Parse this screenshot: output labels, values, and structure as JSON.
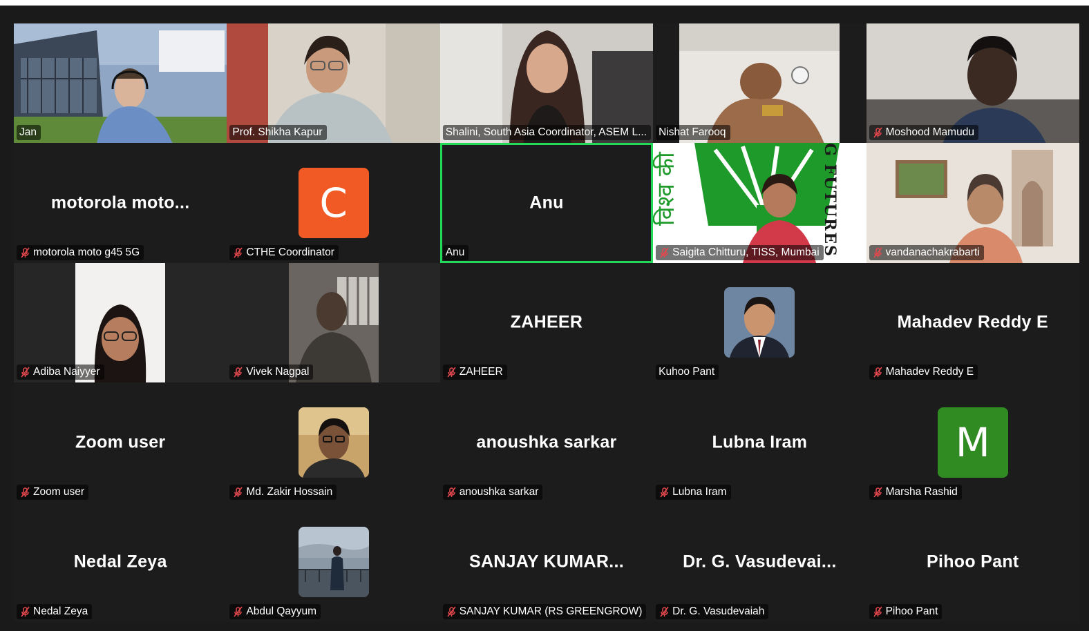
{
  "colors": {
    "background": "#1a1a1a",
    "active_speaker": "#23d959",
    "muted_icon": "#e5484d",
    "avatar_orange": "#f15a24",
    "avatar_green": "#2f8b22"
  },
  "tiles": [
    {
      "label": "Jan",
      "muted": false
    },
    {
      "label": "Prof. Shikha Kapur",
      "muted": false
    },
    {
      "label": "Shalini, South Asia Coordinator, ASEM L...",
      "muted": false
    },
    {
      "label": "Nishat Farooq",
      "muted": false
    },
    {
      "label": "Moshood Mamudu",
      "muted": true
    },
    {
      "label": "motorola moto g45 5G",
      "muted": true,
      "display": "motorola  moto..."
    },
    {
      "label": "CTHE Coordinator",
      "muted": true,
      "avatar_letter": "C"
    },
    {
      "label": "Anu",
      "muted": false,
      "display": "Anu",
      "active": true
    },
    {
      "label": "Saigita Chitturu, TISS, Mumbai",
      "muted": true,
      "background_text": "G FUTURES"
    },
    {
      "label": "vandanachakrabarti",
      "muted": true
    },
    {
      "label": "Adiba Naiyyer",
      "muted": true
    },
    {
      "label": "Vivek Nagpal",
      "muted": true
    },
    {
      "label": "ZAHEER",
      "muted": true,
      "display": "ZAHEER"
    },
    {
      "label": "Kuhoo Pant",
      "muted": false
    },
    {
      "label": "Mahadev Reddy E",
      "muted": true,
      "display": "Mahadev Reddy E"
    },
    {
      "label": "Zoom user",
      "muted": true,
      "display": "Zoom user"
    },
    {
      "label": "Md. Zakir Hossain",
      "muted": true
    },
    {
      "label": "anoushka sarkar",
      "muted": true,
      "display": "anoushka sarkar"
    },
    {
      "label": "Lubna Iram",
      "muted": true,
      "display": "Lubna Iram"
    },
    {
      "label": "Marsha Rashid",
      "muted": true,
      "avatar_letter": "M"
    },
    {
      "label": "Nedal Zeya",
      "muted": true,
      "display": "Nedal Zeya"
    },
    {
      "label": "Abdul Qayyum",
      "muted": true
    },
    {
      "label": "SANJAY KUMAR (RS GREENGROW)",
      "muted": true,
      "display": "SANJAY  KUMAR..."
    },
    {
      "label": "Dr. G. Vasudevaiah",
      "muted": true,
      "display": "Dr.  G.  Vasudevai..."
    },
    {
      "label": "Pihoo Pant",
      "muted": true,
      "display": "Pihoo Pant"
    }
  ]
}
